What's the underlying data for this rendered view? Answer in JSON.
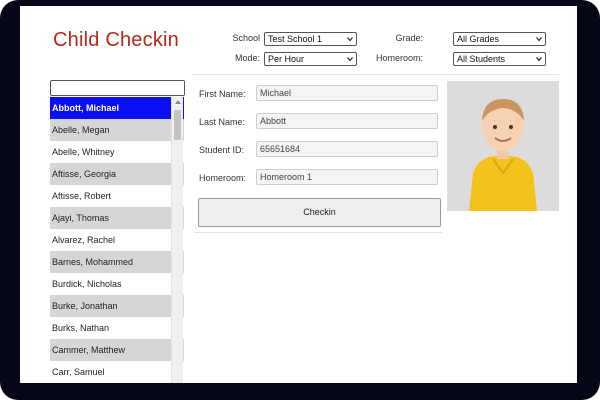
{
  "app": {
    "title": "Child Checkin"
  },
  "filters": {
    "school": {
      "label": "School",
      "value": "Test School 1"
    },
    "mode": {
      "label": "Mode:",
      "value": "Per Hour"
    },
    "grade": {
      "label": "Grade:",
      "value": "All Grades"
    },
    "homeroom": {
      "label": "Homeroom:",
      "value": "All Students"
    }
  },
  "search": {
    "value": ""
  },
  "students": [
    {
      "name": "Abbott, Michael",
      "selected": true
    },
    {
      "name": "Abelle, Megan"
    },
    {
      "name": "Abelle, Whitney"
    },
    {
      "name": "Aftisse, Georgia"
    },
    {
      "name": "Aftisse, Robert"
    },
    {
      "name": "Ajayi, Thomas"
    },
    {
      "name": "Alvarez, Rachel"
    },
    {
      "name": "Barnes, Mohammed"
    },
    {
      "name": "Burdick, Nicholas"
    },
    {
      "name": "Burke, Jonathan"
    },
    {
      "name": "Burks, Nathan"
    },
    {
      "name": "Cammer, Matthew"
    },
    {
      "name": "Carr, Samuel"
    }
  ],
  "details": {
    "first_name": {
      "label": "First Name:",
      "value": "Michael"
    },
    "last_name": {
      "label": "Last Name:",
      "value": "Abbott"
    },
    "student_id": {
      "label": "Student ID:",
      "value": "65651684"
    },
    "homeroom": {
      "label": "Homeroom:",
      "value": "Homeroom 1"
    }
  },
  "actions": {
    "checkin_label": "Checkin"
  },
  "colors": {
    "title": "#b42a1a",
    "selected_row": "#0a0ff5",
    "alt_row": "#d6d6d6",
    "bezel": "#050717"
  },
  "icons": {
    "dropdown": "chevron-down-icon",
    "photo": "student-photo"
  }
}
